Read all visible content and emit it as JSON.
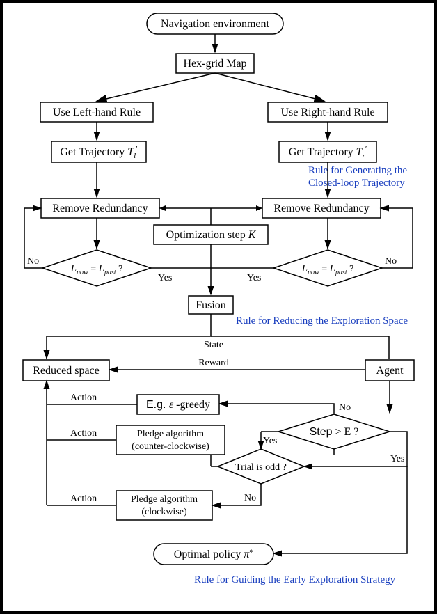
{
  "nodes": {
    "nav_env": "Navigation environment",
    "hex_grid": "Hex-grid Map",
    "left_rule": "Use Left-hand Rule",
    "right_rule": "Use Right-hand Rule",
    "traj_l_a": "Get Trajectory ",
    "traj_l_b": "T",
    "traj_l_c": "l",
    "traj_l_d": "′",
    "traj_r_a": "Get Trajectory ",
    "traj_r_b": "T",
    "traj_r_c": "r",
    "traj_r_d": "′",
    "remove_l": "Remove Redundancy",
    "remove_r": "Remove Redundancy",
    "opt_step_a": "Optimization step ",
    "opt_step_b": "K",
    "cond_l_a": "L",
    "cond_l_b": "now",
    "cond_l_c": " = ",
    "cond_l_d": "L",
    "cond_l_e": "past",
    "cond_l_f": " ?",
    "cond_r_a": "L",
    "cond_r_b": "now",
    "cond_r_c": " = ",
    "cond_r_d": "L",
    "cond_r_e": "past",
    "cond_r_f": " ?",
    "fusion": "Fusion",
    "reduced": "Reduced space",
    "agent": "Agent",
    "greedy_a": "E.g. ",
    "greedy_b": "ε",
    "greedy_c": " -greedy",
    "pledge_ccw_1": "Pledge algorithm",
    "pledge_ccw_2": "(counter-clockwise)",
    "pledge_cw_1": "Pledge algorithm",
    "pledge_cw_2": "(clockwise)",
    "step_e_a": "Step",
    "step_e_b": " > E ?",
    "trial_odd": "Trial is odd ?",
    "optimal_a": "Optimal policy ",
    "optimal_b": "π",
    "optimal_c": "*"
  },
  "labels": {
    "state": "State",
    "reward": "Reward",
    "action1": "Action",
    "action2": "Action",
    "action3": "Action",
    "yes1": "Yes",
    "yes2": "Yes",
    "yes3": "Yes",
    "yes4": "Yes",
    "no1": "No",
    "no2": "No",
    "no3": "No",
    "no4": "No"
  },
  "annotations": {
    "rule1_l1": "Rule for Generating the",
    "rule1_l2": "Closed-loop Trajectory",
    "rule2": "Rule for Reducing the Exploration Space",
    "rule3": "Rule for Guiding the Early Exploration Strategy"
  }
}
